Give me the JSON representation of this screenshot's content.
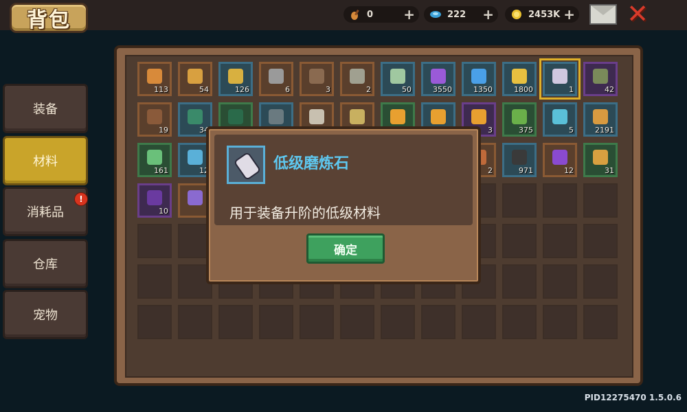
{
  "header": {
    "title": "背包"
  },
  "currencies": [
    {
      "name": "violin-token",
      "value": "0",
      "plus": "+",
      "color": "#d88a3a"
    },
    {
      "name": "gem",
      "value": "222",
      "plus": "+",
      "color": "#3aa0d8"
    },
    {
      "name": "gold-coin",
      "value": "2453K",
      "plus": "+",
      "color": "#e8c030"
    }
  ],
  "sidebar": {
    "items": [
      {
        "label": "装备",
        "active": false
      },
      {
        "label": "材料",
        "active": true
      },
      {
        "label": "消耗品",
        "active": false,
        "badge": "!"
      },
      {
        "label": "仓库",
        "active": false
      },
      {
        "label": "宠物",
        "active": false
      }
    ]
  },
  "inventory": {
    "rows": [
      [
        {
          "icon": "key-icon",
          "qty": "113",
          "frame": "brown",
          "color": "#d88a3a"
        },
        {
          "icon": "scroll-icon",
          "qty": "54",
          "frame": "brown",
          "color": "#d8a040"
        },
        {
          "icon": "coin-icon",
          "qty": "126",
          "frame": "blue",
          "color": "#d8b040"
        },
        {
          "icon": "orb-icon",
          "qty": "6",
          "frame": "brown",
          "color": "#9a9a9a"
        },
        {
          "icon": "scroll-icon",
          "qty": "3",
          "frame": "brown",
          "color": "#8a6a50"
        },
        {
          "icon": "stone-icon",
          "qty": "2",
          "frame": "brown",
          "color": "#a0a090"
        },
        {
          "icon": "crystal-icon",
          "qty": "50",
          "frame": "blue",
          "color": "#a0c8a0"
        },
        {
          "icon": "crystal-icon",
          "qty": "3550",
          "frame": "blue",
          "color": "#9a5ad8"
        },
        {
          "icon": "crystal-icon",
          "qty": "1350",
          "frame": "blue",
          "color": "#4aa0e8"
        },
        {
          "icon": "flame-icon",
          "qty": "1800",
          "frame": "blue",
          "color": "#e8c040"
        },
        {
          "icon": "whetstone-icon",
          "qty": "1",
          "frame": "blue",
          "color": "#d0c8e0",
          "selected": true
        },
        {
          "icon": "spiral-icon",
          "qty": "42",
          "frame": "purple",
          "color": "#7a8a5a"
        }
      ],
      [
        {
          "icon": "ring-icon",
          "qty": "19",
          "frame": "brown",
          "color": "#8a5a3a"
        },
        {
          "icon": "leaf-icon",
          "qty": "34",
          "frame": "blue",
          "color": "#3a8a6a"
        },
        {
          "icon": "drop-icon",
          "qty": "",
          "frame": "green",
          "color": "#2a6a4a"
        },
        {
          "icon": "box-icon",
          "qty": "",
          "frame": "blue",
          "color": "#6a7a80"
        },
        {
          "icon": "feather-icon",
          "qty": "",
          "frame": "brown",
          "color": "#c8c0b0"
        },
        {
          "icon": "shell-icon",
          "qty": "",
          "frame": "brown",
          "color": "#c8b060"
        },
        {
          "icon": "crown-icon",
          "qty": "",
          "frame": "green",
          "color": "#e8a030"
        },
        {
          "icon": "crown-icon",
          "qty": "",
          "frame": "blue",
          "color": "#e8a030"
        },
        {
          "icon": "crown-icon",
          "qty": "3",
          "frame": "purple",
          "color": "#e8a030"
        },
        {
          "icon": "leaf-icon",
          "qty": "375",
          "frame": "green",
          "color": "#6ab04a"
        },
        {
          "icon": "leaf-icon",
          "qty": "5",
          "frame": "blue",
          "color": "#5ac0d8"
        },
        {
          "icon": "pouch-icon",
          "qty": "2191",
          "frame": "blue",
          "color": "#d89a40"
        }
      ],
      [
        {
          "icon": "map-icon",
          "qty": "161",
          "frame": "green",
          "color": "#6ac07a"
        },
        {
          "icon": "map-icon",
          "qty": "12",
          "frame": "blue",
          "color": "#5ab0d8"
        },
        null,
        null,
        null,
        null,
        null,
        null,
        {
          "icon": "ore-icon",
          "qty": "2",
          "frame": "brown",
          "color": "#c06a3a"
        },
        {
          "icon": "ingot-icon",
          "qty": "971",
          "frame": "blue",
          "color": "#3a3a3a"
        },
        {
          "icon": "gem-shard-icon",
          "qty": "12",
          "frame": "brown",
          "color": "#8a4ad0"
        },
        {
          "icon": "map-icon",
          "qty": "31",
          "frame": "green",
          "color": "#d8a040"
        }
      ],
      [
        {
          "icon": "book-icon",
          "qty": "10",
          "frame": "purple",
          "color": "#6a3aa0"
        },
        {
          "icon": "book-icon",
          "qty": "",
          "frame": "brown",
          "color": "#8a6ad0"
        }
      ]
    ]
  },
  "modal": {
    "title": "低级磨炼石",
    "description": "用于装备升阶的低级材料",
    "confirm_label": "确定"
  },
  "footer": {
    "version": "PID12275470 1.5.0.6"
  }
}
